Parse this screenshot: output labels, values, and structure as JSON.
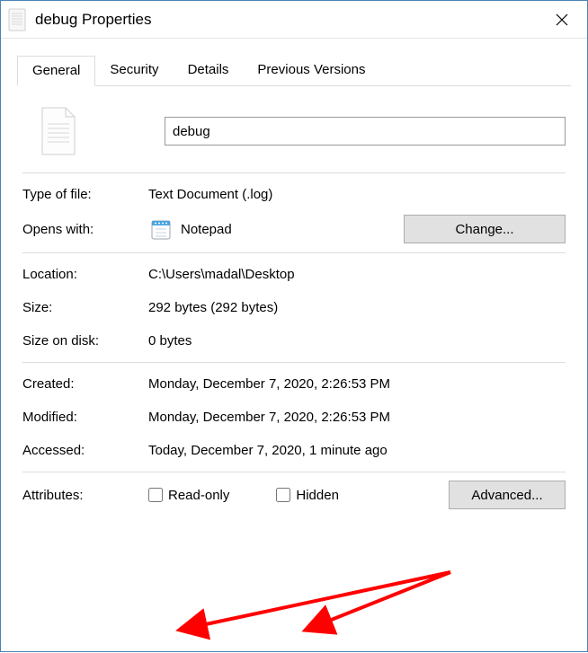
{
  "window": {
    "title": "debug Properties"
  },
  "tabs": {
    "general": "General",
    "security": "Security",
    "details": "Details",
    "previous": "Previous Versions"
  },
  "file": {
    "name": "debug"
  },
  "labels": {
    "type_of_file": "Type of file:",
    "opens_with": "Opens with:",
    "location": "Location:",
    "size": "Size:",
    "size_on_disk": "Size on disk:",
    "created": "Created:",
    "modified": "Modified:",
    "accessed": "Accessed:",
    "attributes": "Attributes:"
  },
  "values": {
    "type_of_file": "Text Document (.log)",
    "opens_with": "Notepad",
    "location": "C:\\Users\\madal\\Desktop",
    "size": "292 bytes (292 bytes)",
    "size_on_disk": "0 bytes",
    "created": "Monday, December 7, 2020, 2:26:53 PM",
    "modified": "Monday, December 7, 2020, 2:26:53 PM",
    "accessed": "Today, December 7, 2020, 1 minute ago"
  },
  "buttons": {
    "change": "Change...",
    "advanced": "Advanced..."
  },
  "attributes": {
    "readonly": "Read-only",
    "hidden": "Hidden"
  }
}
